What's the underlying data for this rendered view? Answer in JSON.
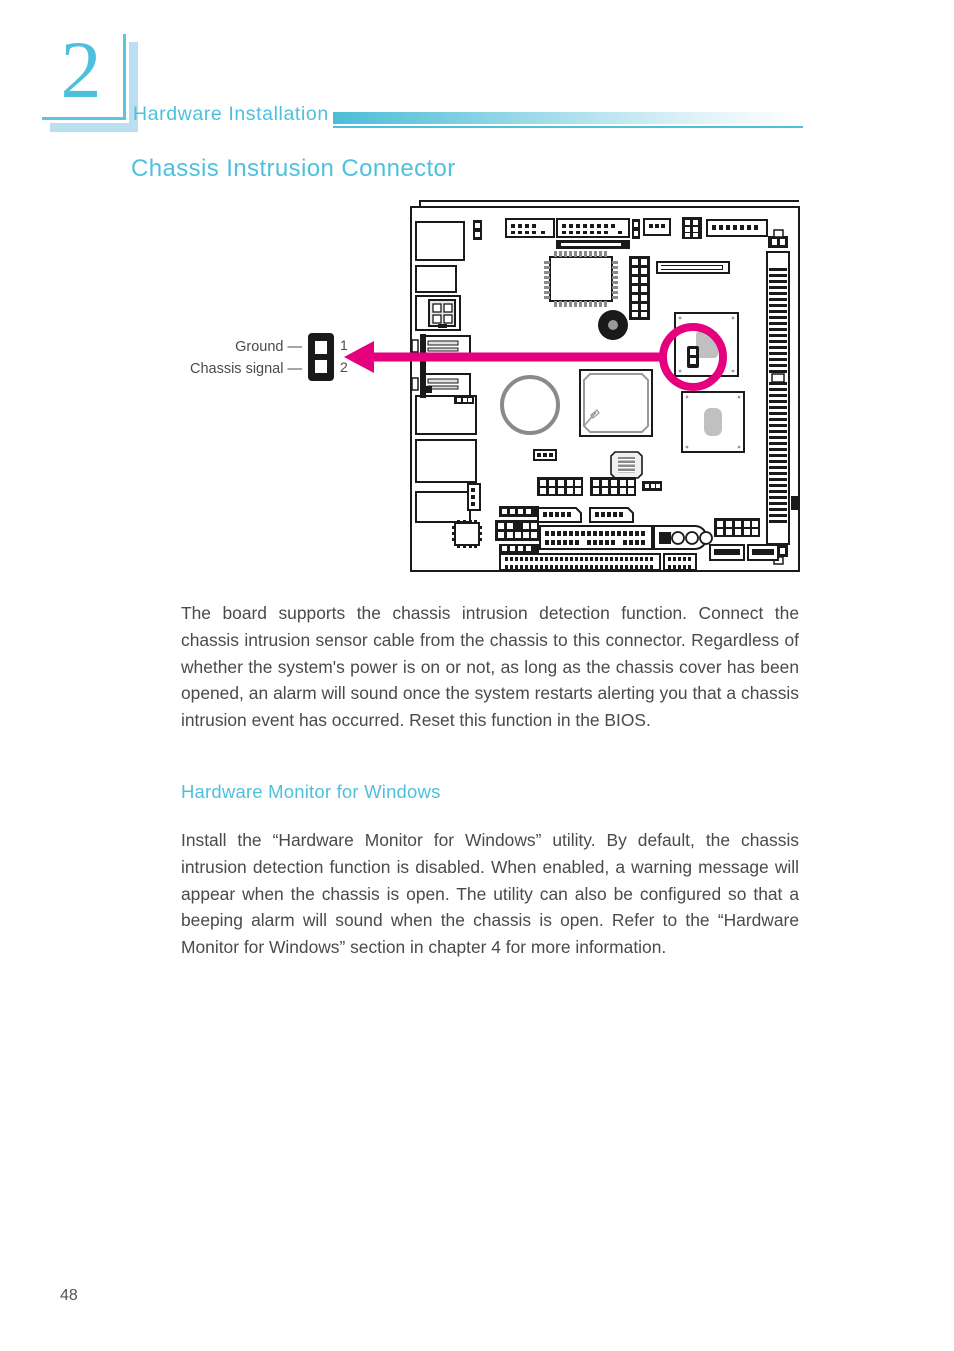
{
  "page": {
    "number": "48",
    "accent_color": "#4ec0de",
    "accent_light_color": "#b9dff0",
    "highlight_color": "#e6007e",
    "text_color": "#4a4a4a"
  },
  "header": {
    "chapter_number": "2",
    "running_title": "Hardware Installation"
  },
  "section": {
    "title": "Chassis Instrusion Connector"
  },
  "figure": {
    "name": "chassis-intrusion-connector-diagram",
    "callout_labels": [
      "Ground —",
      "Chassis  signal —"
    ],
    "pin_numbers": [
      "1",
      "2"
    ],
    "connector_pin_count": 2,
    "highlight_color": "#e6007e",
    "board_outline_color": "#1a1a1a"
  },
  "content": {
    "intro_paragraph": "The board supports the chassis intrusion detection function. Connect the chassis intrusion sensor cable from the chassis to this connector. Regardless of whether the system's power is on or not, as long as the chassis cover has been opened, an alarm will sound once the system restarts alerting you that a chassis intrusion event has occurred. Reset this function in the BIOS.",
    "subsection_title": "Hardware Monitor for Windows",
    "monitor_paragraph": "Install the “Hardware Monitor for Windows” utility. By default, the chassis intrusion detection function is disabled. When enabled, a warning message will appear when the chassis is open. The utility can also be configured so that a beeping alarm will sound when the chassis is open. Refer to the “Hardware Monitor for Windows” section in chapter 4 for more information."
  }
}
